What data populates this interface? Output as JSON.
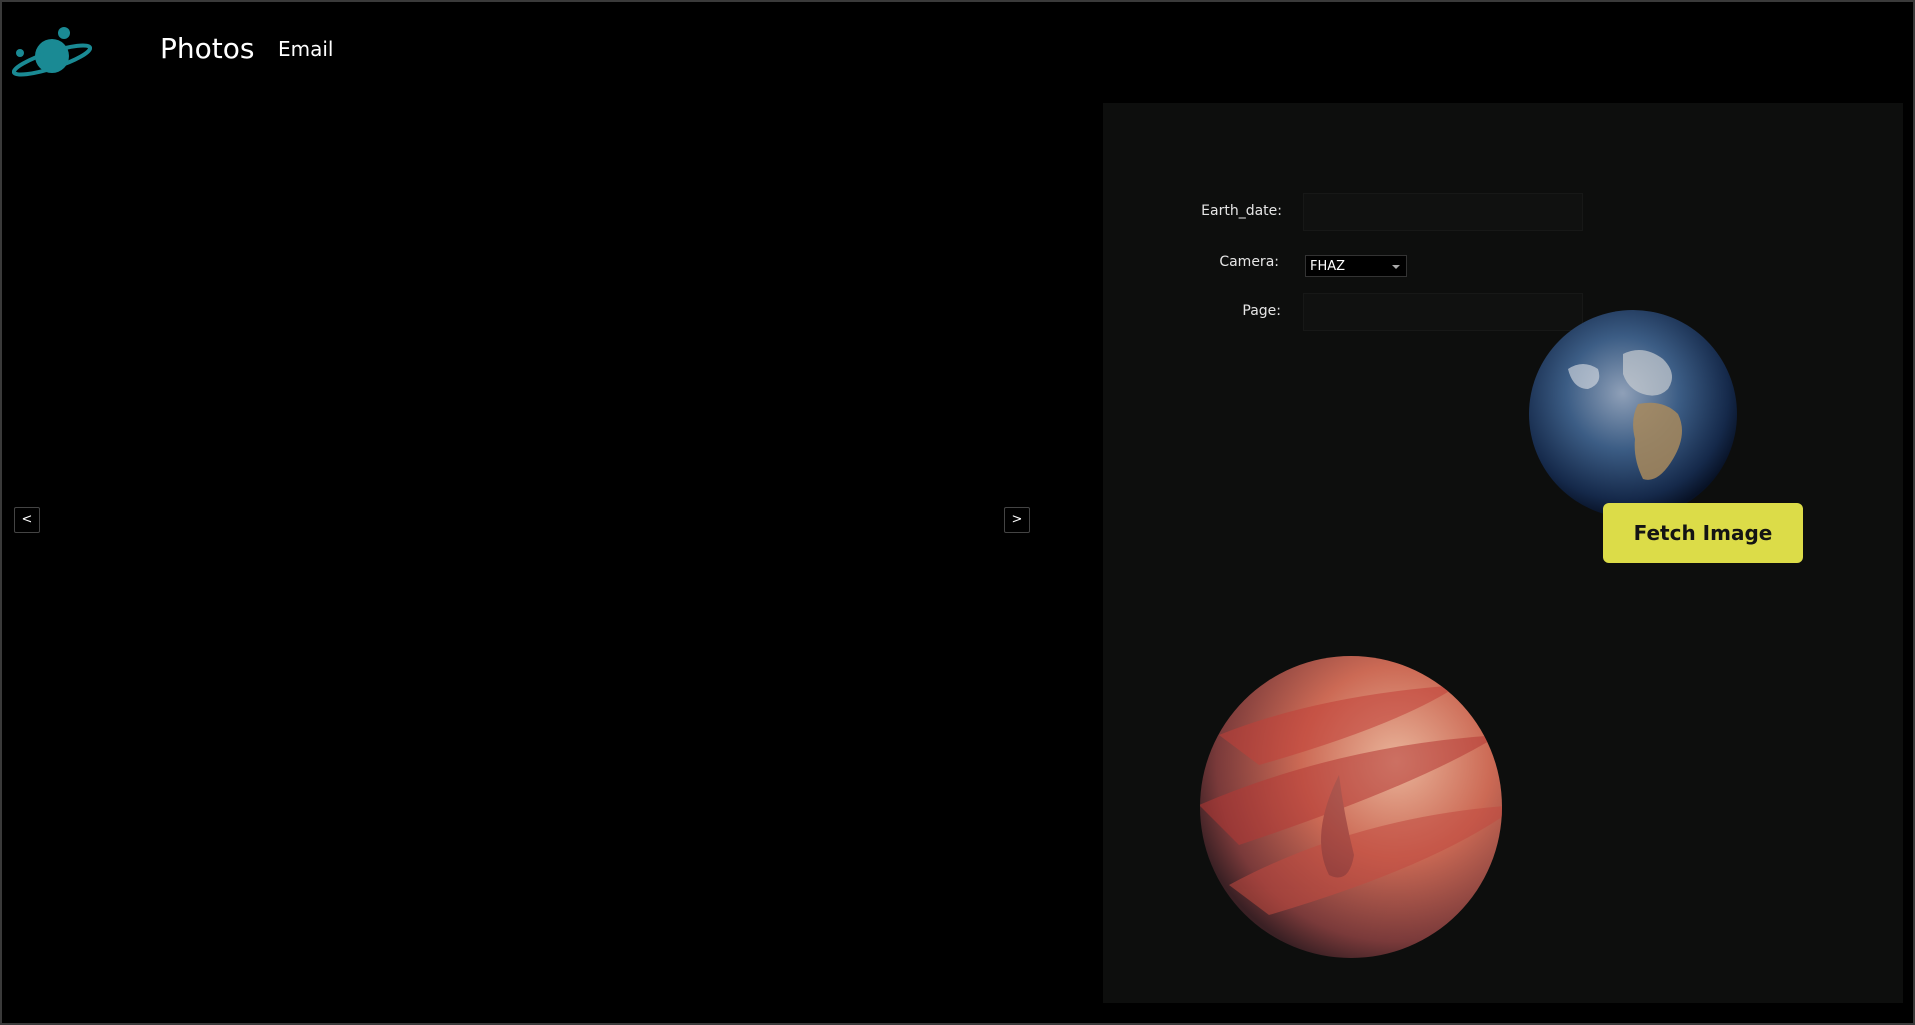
{
  "nav": {
    "logo_icon": "saturn-logo-icon",
    "photos_label": "Photos",
    "email_label": "Email"
  },
  "carousel": {
    "prev_label": "<",
    "next_label": ">"
  },
  "form": {
    "earth_date_label": "Earth_date:",
    "earth_date_value": "",
    "camera_label": "Camera:",
    "camera_selected": "FHAZ",
    "page_label": "Page:",
    "page_value": "",
    "fetch_button_label": "Fetch Image"
  },
  "colors": {
    "accent": "#dcdc48",
    "logo": "#1a8a94",
    "panel_bg": "#0d0e0d"
  },
  "decorations": {
    "earth_icon": "earth-globe-icon",
    "planet_icon": "red-gas-planet-icon"
  }
}
